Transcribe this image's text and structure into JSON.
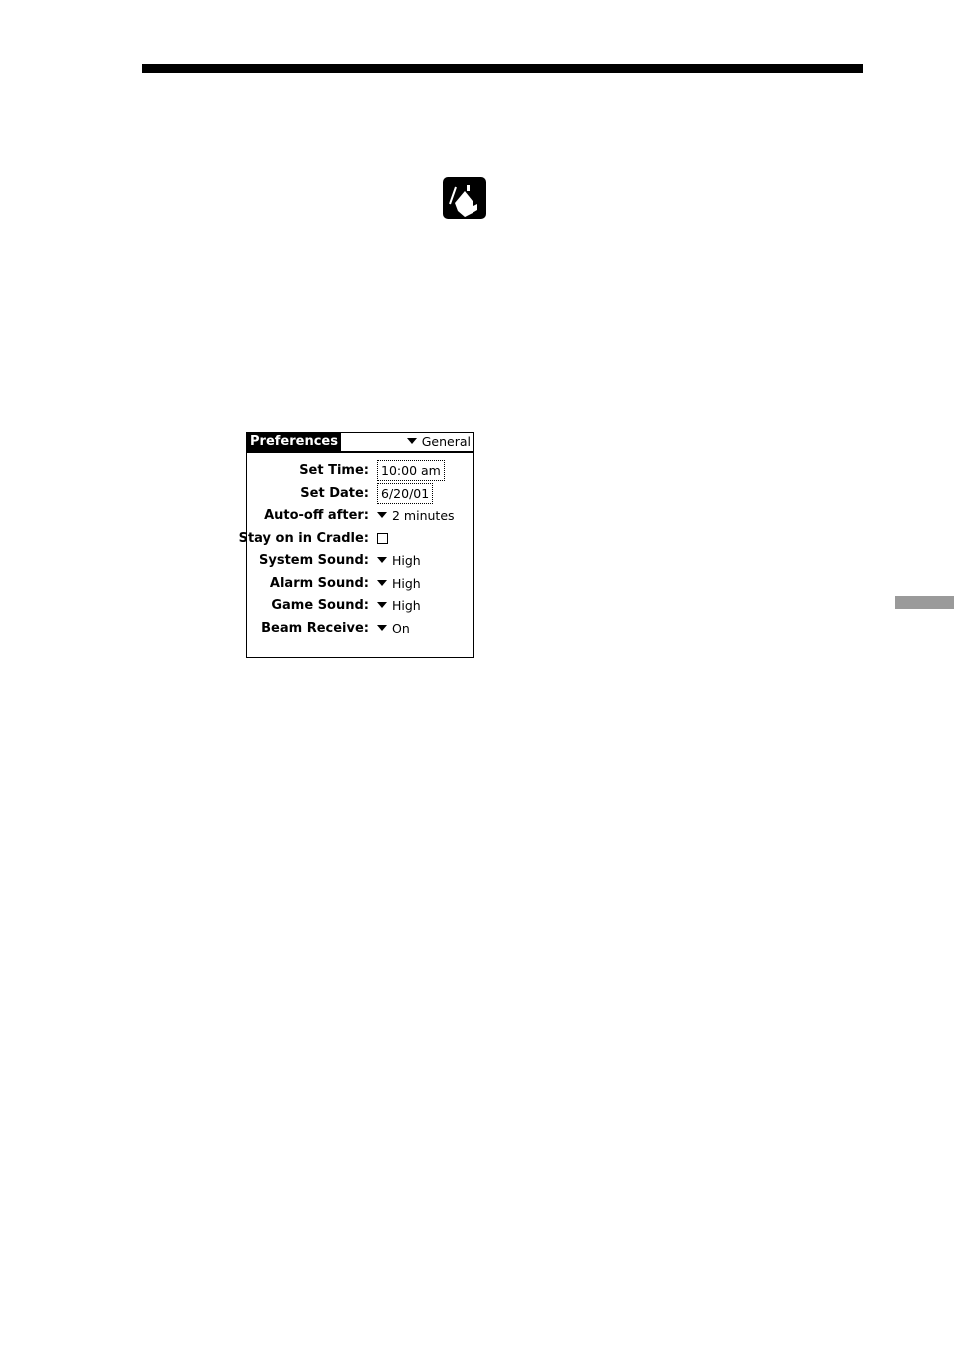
{
  "page": {
    "app_icon": "prefs-house-icon"
  },
  "prefs": {
    "title": "Preferences",
    "category": "General",
    "rows": [
      {
        "label": "Set Time:",
        "value": "10:00 am",
        "type": "box"
      },
      {
        "label": "Set Date:",
        "value": "6/20/01",
        "type": "box"
      },
      {
        "label": "Auto-off after:",
        "value": "2 minutes",
        "type": "popup"
      },
      {
        "label": "Stay on in Cradle:",
        "value": "",
        "type": "checkbox",
        "checked": false
      },
      {
        "label": "System Sound:",
        "value": "High",
        "type": "popup"
      },
      {
        "label": "Alarm Sound:",
        "value": "High",
        "type": "popup"
      },
      {
        "label": "Game Sound:",
        "value": "High",
        "type": "popup"
      },
      {
        "label": "Beam Receive:",
        "value": "On",
        "type": "popup"
      }
    ]
  }
}
